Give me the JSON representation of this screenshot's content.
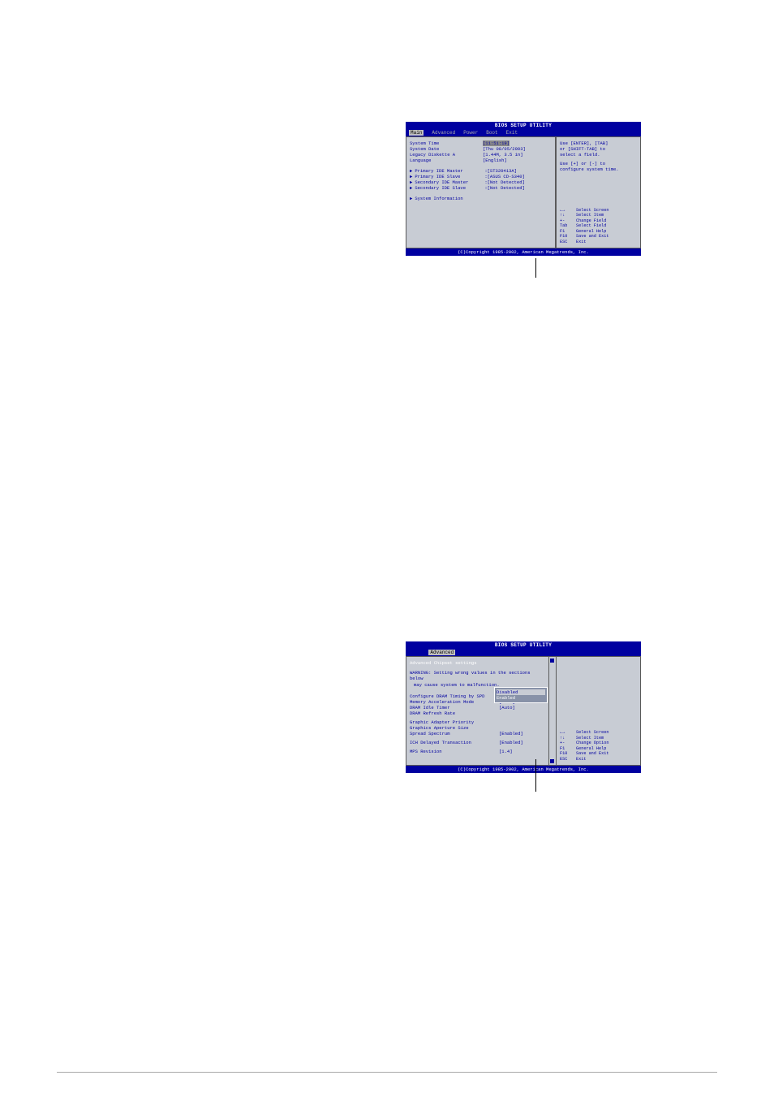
{
  "bios1": {
    "title": "BIOS SETUP UTILITY",
    "tabs": [
      "Main",
      "Advanced",
      "Power",
      "Boot",
      "Exit"
    ],
    "active_tab": "Main",
    "fields": {
      "system_time": {
        "label": "System Time",
        "value": "[11:51:19]"
      },
      "system_date": {
        "label": "System Date",
        "value": "[Thu 08/05/2003]"
      },
      "legacy": {
        "label": "Legacy Diskette A",
        "value": "[1.44M, 3.5 in]"
      },
      "lang": {
        "label": "Language",
        "value": "[English]"
      },
      "pim": {
        "label": "Primary IDE Master",
        "value": ":[ST320413A]"
      },
      "pis": {
        "label": "Primary IDE Slave",
        "value": ":[ASUS CD-S340]"
      },
      "sim": {
        "label": "Secondary IDE Master",
        "value": ":[Not Detected]"
      },
      "sis": {
        "label": "Secondary IDE Slave",
        "value": ":[Not Detected]"
      },
      "sysinfo": {
        "label": "System Information",
        "value": ""
      }
    },
    "help": {
      "l1": "Use [ENTER], [TAB]",
      "l2": "or [SHIFT-TAB] to",
      "l3": "select a field.",
      "l4": "Use [+] or [-] to",
      "l5": "configure system time."
    },
    "keys": [
      {
        "k": "",
        "t": "Select Screen"
      },
      {
        "k": "",
        "t": "Select Item"
      },
      {
        "k": "+-",
        "t": "Change Field"
      },
      {
        "k": "Tab",
        "t": "Select Field"
      },
      {
        "k": "F1",
        "t": "General Help"
      },
      {
        "k": "F10",
        "t": "Save and Exit"
      },
      {
        "k": "ESC",
        "t": "Exit"
      }
    ],
    "footer": "(C)Copyright 1985-2002, American Megatrends, Inc."
  },
  "bios2": {
    "title": "BIOS SETUP UTILITY",
    "active_tab": "Advanced",
    "heading": "Advanced Chipset settings",
    "warn1": "WARNING: Setting wrong values in the sections below",
    "warn2": "         may cause system to malfunction.",
    "fields": {
      "dram_spd": {
        "label": "Configure DRAM Timing by SPD",
        "value": "[Enabled]"
      },
      "mam": {
        "label": "Memory Acceleration Mode",
        "value": "[Auto]"
      },
      "dit": {
        "label": "DRAM Idle Timer",
        "value": "[Auto]"
      },
      "drr": {
        "label": "DRAM Refresh Rate",
        "value": ""
      },
      "gap": {
        "label": "Graphic Adapter Priority",
        "value": ""
      },
      "gas": {
        "label": "Graphics Aperture Size",
        "value": ""
      },
      "ss": {
        "label": "Spread Spectrum",
        "value": "[Enabled]"
      },
      "ich": {
        "label": "ICH Delayed Transaction",
        "value": "[Enabled]"
      },
      "mps": {
        "label": "MPS Revision",
        "value": "[1.4]"
      }
    },
    "popup": {
      "opt1": "Disabled",
      "opt2": "Enabled"
    },
    "keys": [
      {
        "k": "",
        "t": "Select Screen"
      },
      {
        "k": "",
        "t": "Select Item"
      },
      {
        "k": "+-",
        "t": "Change Option"
      },
      {
        "k": "F1",
        "t": "General Help"
      },
      {
        "k": "F10",
        "t": "Save and Exit"
      },
      {
        "k": "ESC",
        "t": "Exit"
      }
    ],
    "footer": "(C)Copyright 1985-2002, American Megatrends, Inc."
  }
}
